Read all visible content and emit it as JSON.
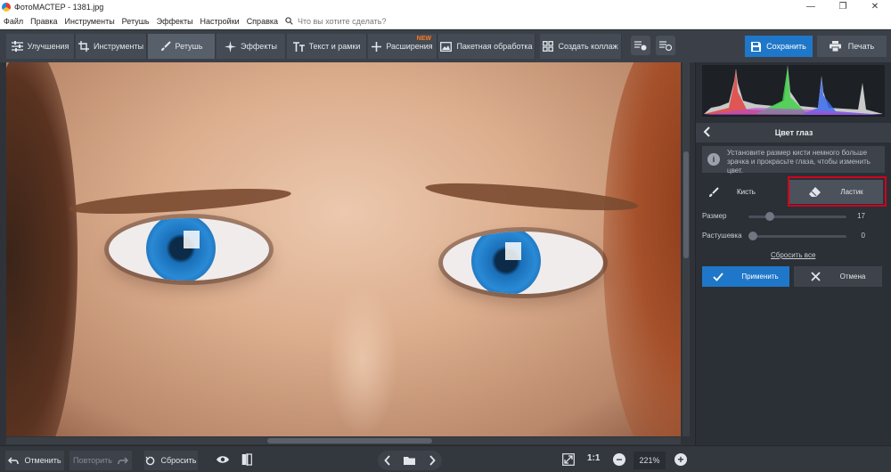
{
  "window": {
    "title": "ФотоМАСТЕР - 1381.jpg",
    "controls": [
      "—",
      "❐",
      "✕"
    ]
  },
  "menu": {
    "items": [
      "Файл",
      "Правка",
      "Инструменты",
      "Ретушь",
      "Эффекты",
      "Настройки",
      "Справка"
    ],
    "search_placeholder": "Что вы хотите сделать?"
  },
  "toolbar": {
    "tabs": [
      {
        "label": "Улучшения",
        "icon": "sliders-icon"
      },
      {
        "label": "Инструменты",
        "icon": "crop-icon"
      },
      {
        "label": "Ретушь",
        "icon": "brush-icon",
        "active": true
      },
      {
        "label": "Эффекты",
        "icon": "sparkle-icon"
      },
      {
        "label": "Текст и рамки",
        "icon": "text-icon"
      },
      {
        "label": "Расширения",
        "icon": "plus-icon",
        "badge": "NEW"
      },
      {
        "label": "Пакетная обработка",
        "icon": "images-icon"
      },
      {
        "label": "Создать коллаж",
        "icon": "grid-icon"
      }
    ],
    "save_label": "Сохранить",
    "print_label": "Печать"
  },
  "panel": {
    "title": "Цвет глаз",
    "info": "Установите размер кисти немного больше зрачка и прокрасьте глаза, чтобы изменить цвет.",
    "tools": {
      "brush": "Кисть",
      "eraser": "Ластик",
      "selected": "eraser"
    },
    "sliders": [
      {
        "label": "Размер",
        "value": 17
      },
      {
        "label": "Растушевка",
        "value": 0
      }
    ],
    "reset_all": "Сбросить все",
    "apply": "Применить",
    "cancel": "Отмена"
  },
  "bottom": {
    "undo": "Отменить",
    "redo": "Повторить",
    "reset": "Сбросить",
    "actual_size": "1:1",
    "zoom": "221%"
  },
  "colors": {
    "accent": "#1f77c9",
    "highlight_frame": "#d0021b",
    "new_badge": "#ff7a1a"
  }
}
